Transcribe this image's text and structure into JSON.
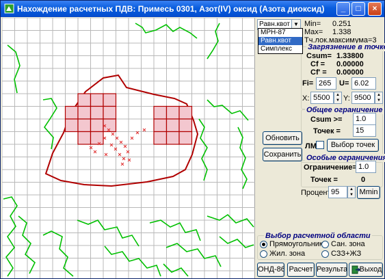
{
  "window": {
    "title": "Нахождение расчетных ПДВ: Примесь 0301, Азот(IV) оксид (Азота диоксид)",
    "minimize": "_",
    "maximize": "□",
    "close": "×"
  },
  "method": {
    "selected": "Равн.квот",
    "options": [
      "МРН-87",
      "Равн.квот",
      "Симплекс"
    ]
  },
  "stats": {
    "min_label": "Min=",
    "min_value": "0.251",
    "max_label": "Max=",
    "max_value": "1.338",
    "local_max": "Тч.лок.максимума=3"
  },
  "point_pollution": {
    "heading": "Загрязнение в точке",
    "csum_label": "Csum=",
    "csum_value": "1.33800",
    "cf_label": "Cf =",
    "cf_value": "0.00000",
    "cf2_label": "Cf' =",
    "cf2_value": "0.00000",
    "fi_label": "Fi=",
    "fi_value": "265",
    "u_label": "U=",
    "u_value": "6.02",
    "x_label": "X:",
    "x_value": "5500",
    "y_label": "Y:",
    "y_value": "9500"
  },
  "general_limit": {
    "heading": "Общее ограничение",
    "csum_label": "Csum >=",
    "csum_value": "1.0",
    "points_label": "Точек =",
    "points_value": "15",
    "lm_label": "ЛМ",
    "select_points_button": "Выбор точек"
  },
  "side_buttons": {
    "update": "Обновить",
    "save": "Сохранить"
  },
  "special_limit": {
    "heading": "Особые ограничения",
    "limit_label": "Ограничение=",
    "limit_value": "1.0",
    "points_label": "Точек =",
    "points_value": "0"
  },
  "percent": {
    "label": "Процент",
    "value": "95",
    "mmin_button": "Mmin"
  },
  "calc_area": {
    "heading": "Выбор расчетной области",
    "options": [
      "Прямоугольник",
      "Сан. зона",
      "Жил. зона",
      "СЗЗ+ЖЗ"
    ],
    "selected": "Прямоугольник"
  },
  "bottom_buttons": {
    "ond": "ОНД-86",
    "calc": "Расчет",
    "results": "Результат",
    "exit": "Выход"
  },
  "colors": {
    "titlebar": "#0a5ddd",
    "heading_blue": "#000080",
    "contour_red": "#b00000",
    "contour_green": "#00c000",
    "grid": "#b8b8b8"
  }
}
